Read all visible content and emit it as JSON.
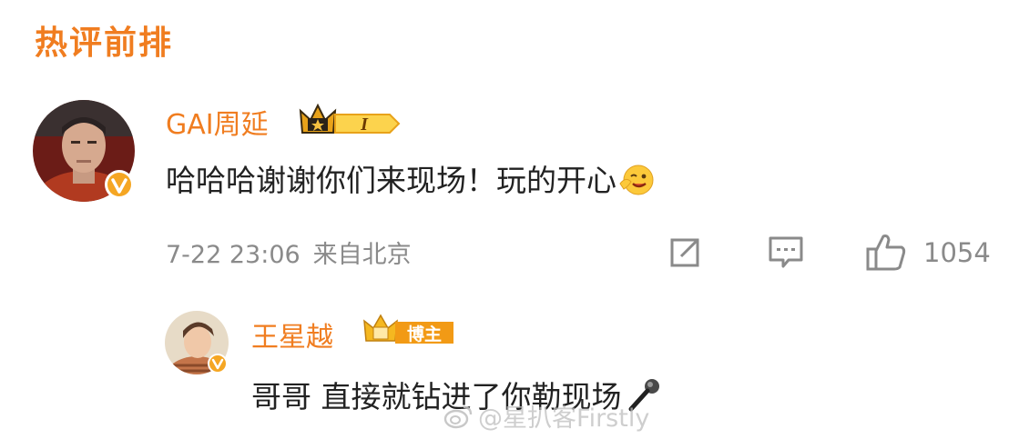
{
  "section": {
    "title": "热评前排"
  },
  "top_comment": {
    "username": "GAI周延",
    "badge_level": "I",
    "text": "哈哈哈谢谢你们来现场！玩的开心",
    "emoji": "winking-face-emoji",
    "timestamp": "7-22 23:06",
    "location": "来自北京",
    "likes": "1054",
    "colors": {
      "username": "#f07d20",
      "badge": "#f5a623"
    }
  },
  "reply": {
    "username": "王星越",
    "badge_label": "博主",
    "text": "哥哥 直接就钻进了你勒现场",
    "emoji": "microphone-emoji"
  },
  "watermark": {
    "text": "@星扒客Firstly",
    "icon": "weibo-icon"
  }
}
